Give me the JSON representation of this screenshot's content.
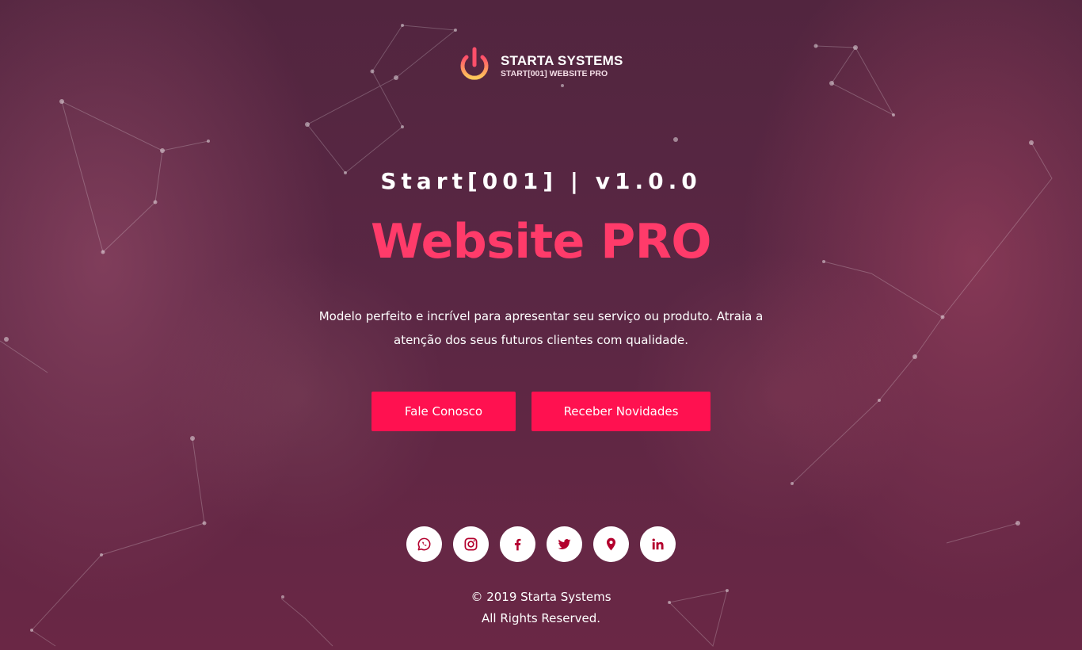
{
  "brand": {
    "name": "STARTA SYSTEMS",
    "tagline": "START[001] WEBSITE PRO"
  },
  "hero": {
    "version": "Start[001] | v1.0.0",
    "headline": "Website PRO",
    "description": "Modelo perfeito e incrível para apresentar seu serviço ou produto. Atraia a atenção dos seus futuros clientes com qualidade."
  },
  "buttons": {
    "contact_label": "Fale Conosco",
    "news_label": "Receber Novidades"
  },
  "social": [
    {
      "icon": "whatsapp-icon"
    },
    {
      "icon": "instagram-icon"
    },
    {
      "icon": "facebook-icon"
    },
    {
      "icon": "twitter-icon"
    },
    {
      "icon": "map-pin-icon"
    },
    {
      "icon": "linkedin-icon"
    }
  ],
  "footer": {
    "copyright": "© 2019 Starta Systems",
    "rights": "All Rights Reserved."
  },
  "colors": {
    "accent": "#ff1150",
    "headline": "#ff3b6a",
    "icon": "#b3002d"
  }
}
